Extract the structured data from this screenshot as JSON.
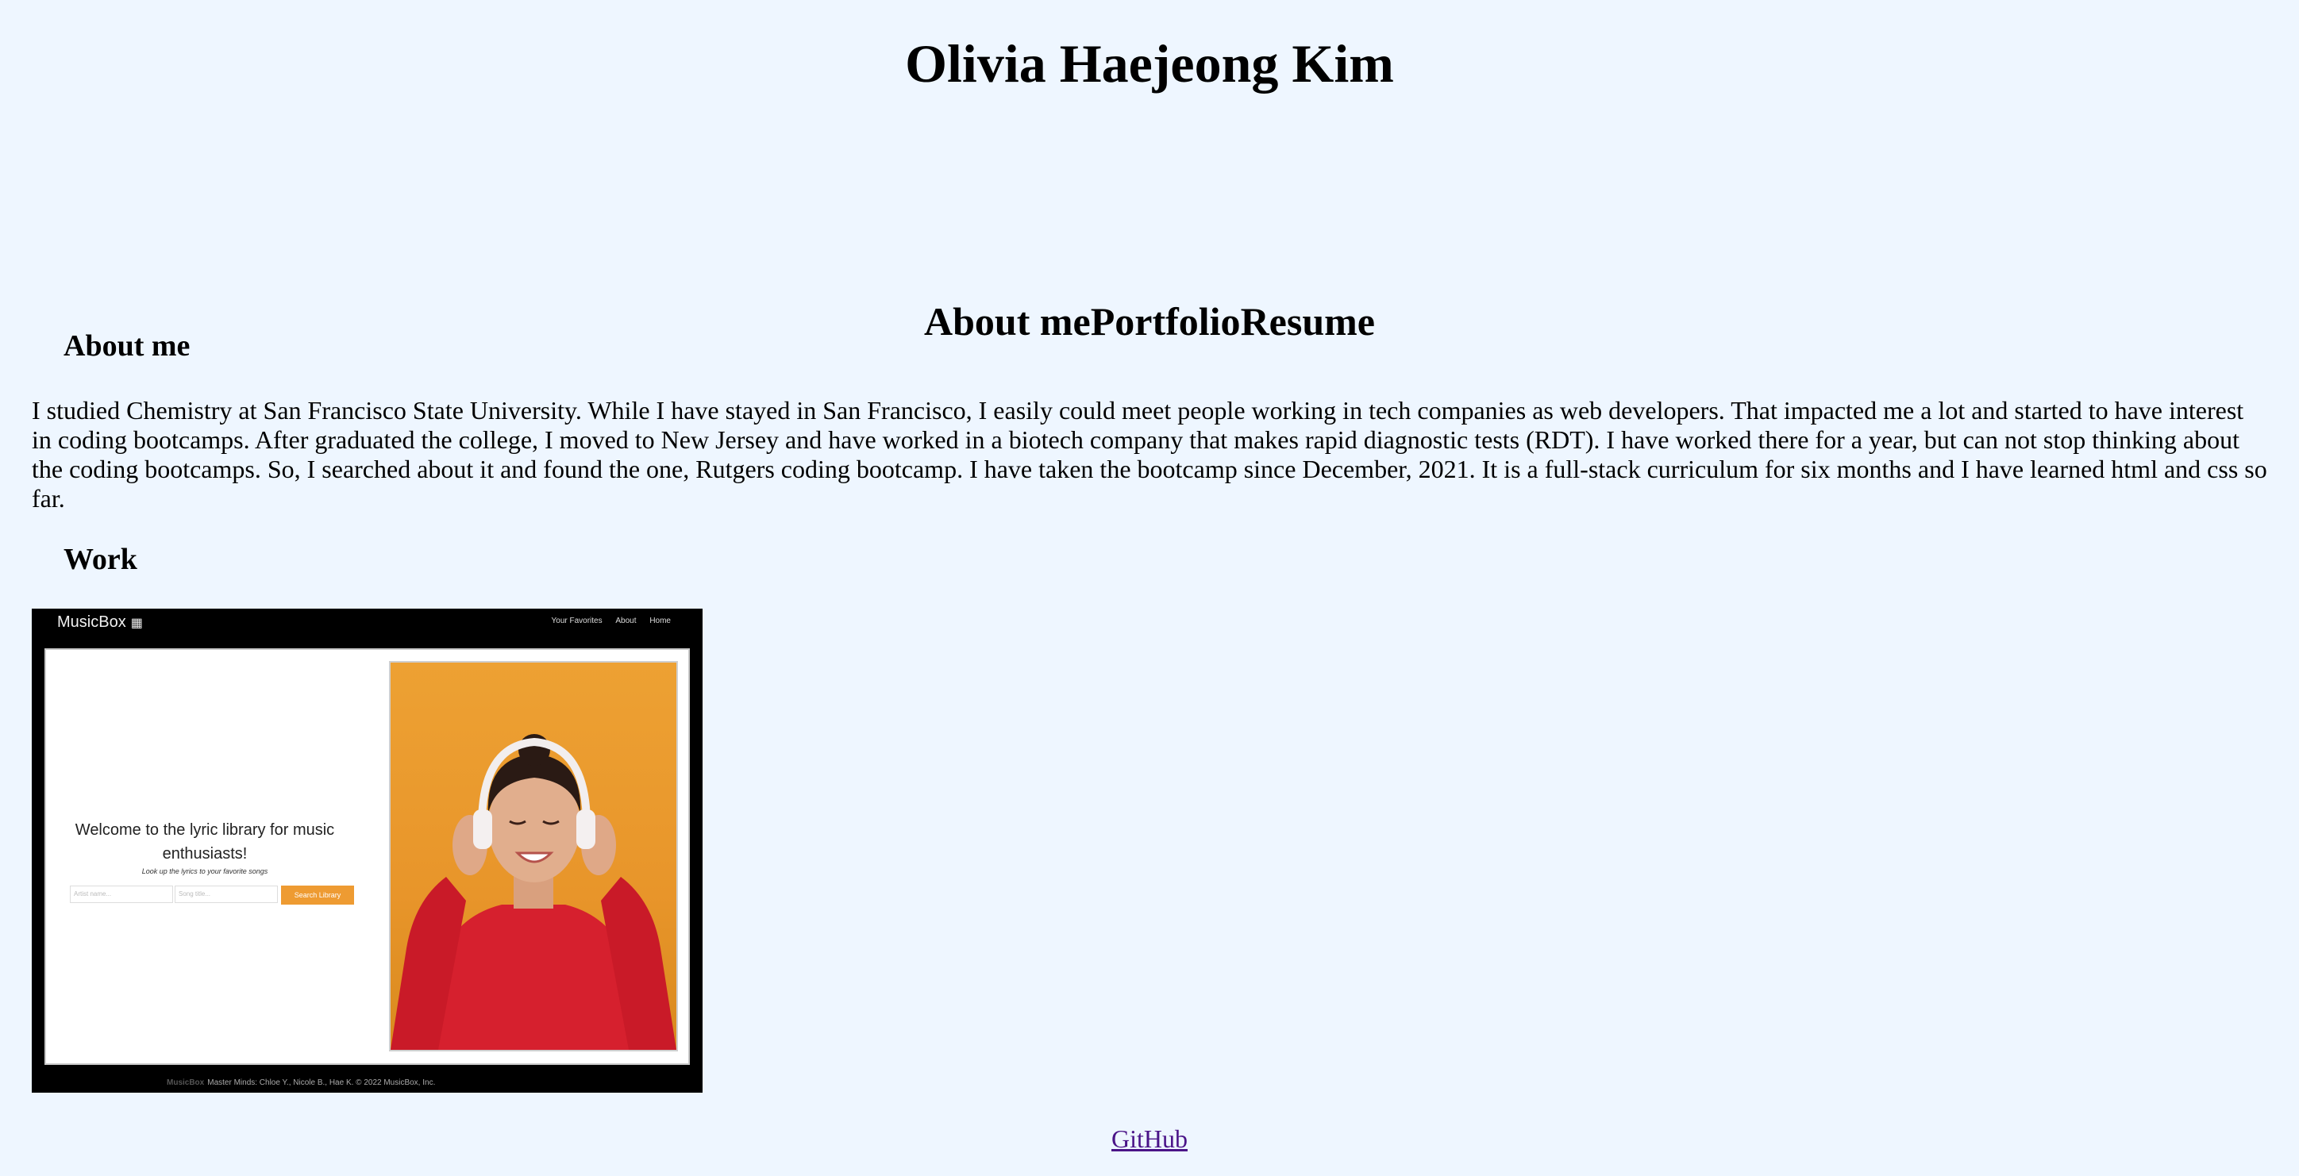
{
  "header": {
    "title": "Olivia Haejeong Kim"
  },
  "nav": {
    "items": [
      {
        "label": "About me"
      },
      {
        "label": "Portfolio"
      },
      {
        "label": "Resume"
      }
    ]
  },
  "about": {
    "heading": "About me",
    "text": "I studied Chemistry at San Francisco State University. While I have stayed in San Francisco, I easily could meet people working in tech companies as web developers. That impacted me a lot and started to have interest in coding bootcamps. After graduated the college, I moved to New Jersey and have worked in a biotech company that makes rapid diagnostic tests (RDT). I have worked there for a year, but can not stop thinking about the coding bootcamps. So, I searched about it and found the one, Rutgers coding bootcamp. I have taken the bootcamp since December, 2021. It is a full-stack curriculum for six months and I have learned html and css so far."
  },
  "work": {
    "heading": "Work",
    "project": {
      "brand": "MusicBox",
      "brand_icon": "qr-code-icon",
      "nav_links": [
        "Your Favorites",
        "About",
        "Home"
      ],
      "welcome_line1": "Welcome to the lyric library for music",
      "welcome_line2": "enthusiasts!",
      "subtitle": "Look up the lyrics to your favorite songs",
      "artist_placeholder": "Artist name...",
      "song_placeholder": "Song title...",
      "search_label": "Search Library",
      "footer_brand": "MusicBox",
      "footer_text": "Master Minds: Chloe Y., Nicole B., Hae K. © 2022 MusicBox, Inc.",
      "accent_color": "#ee9b32"
    }
  },
  "footer": {
    "link_label": "GitHub"
  },
  "colors": {
    "background": "#eef6ff",
    "link_visited": "#4a1488"
  }
}
